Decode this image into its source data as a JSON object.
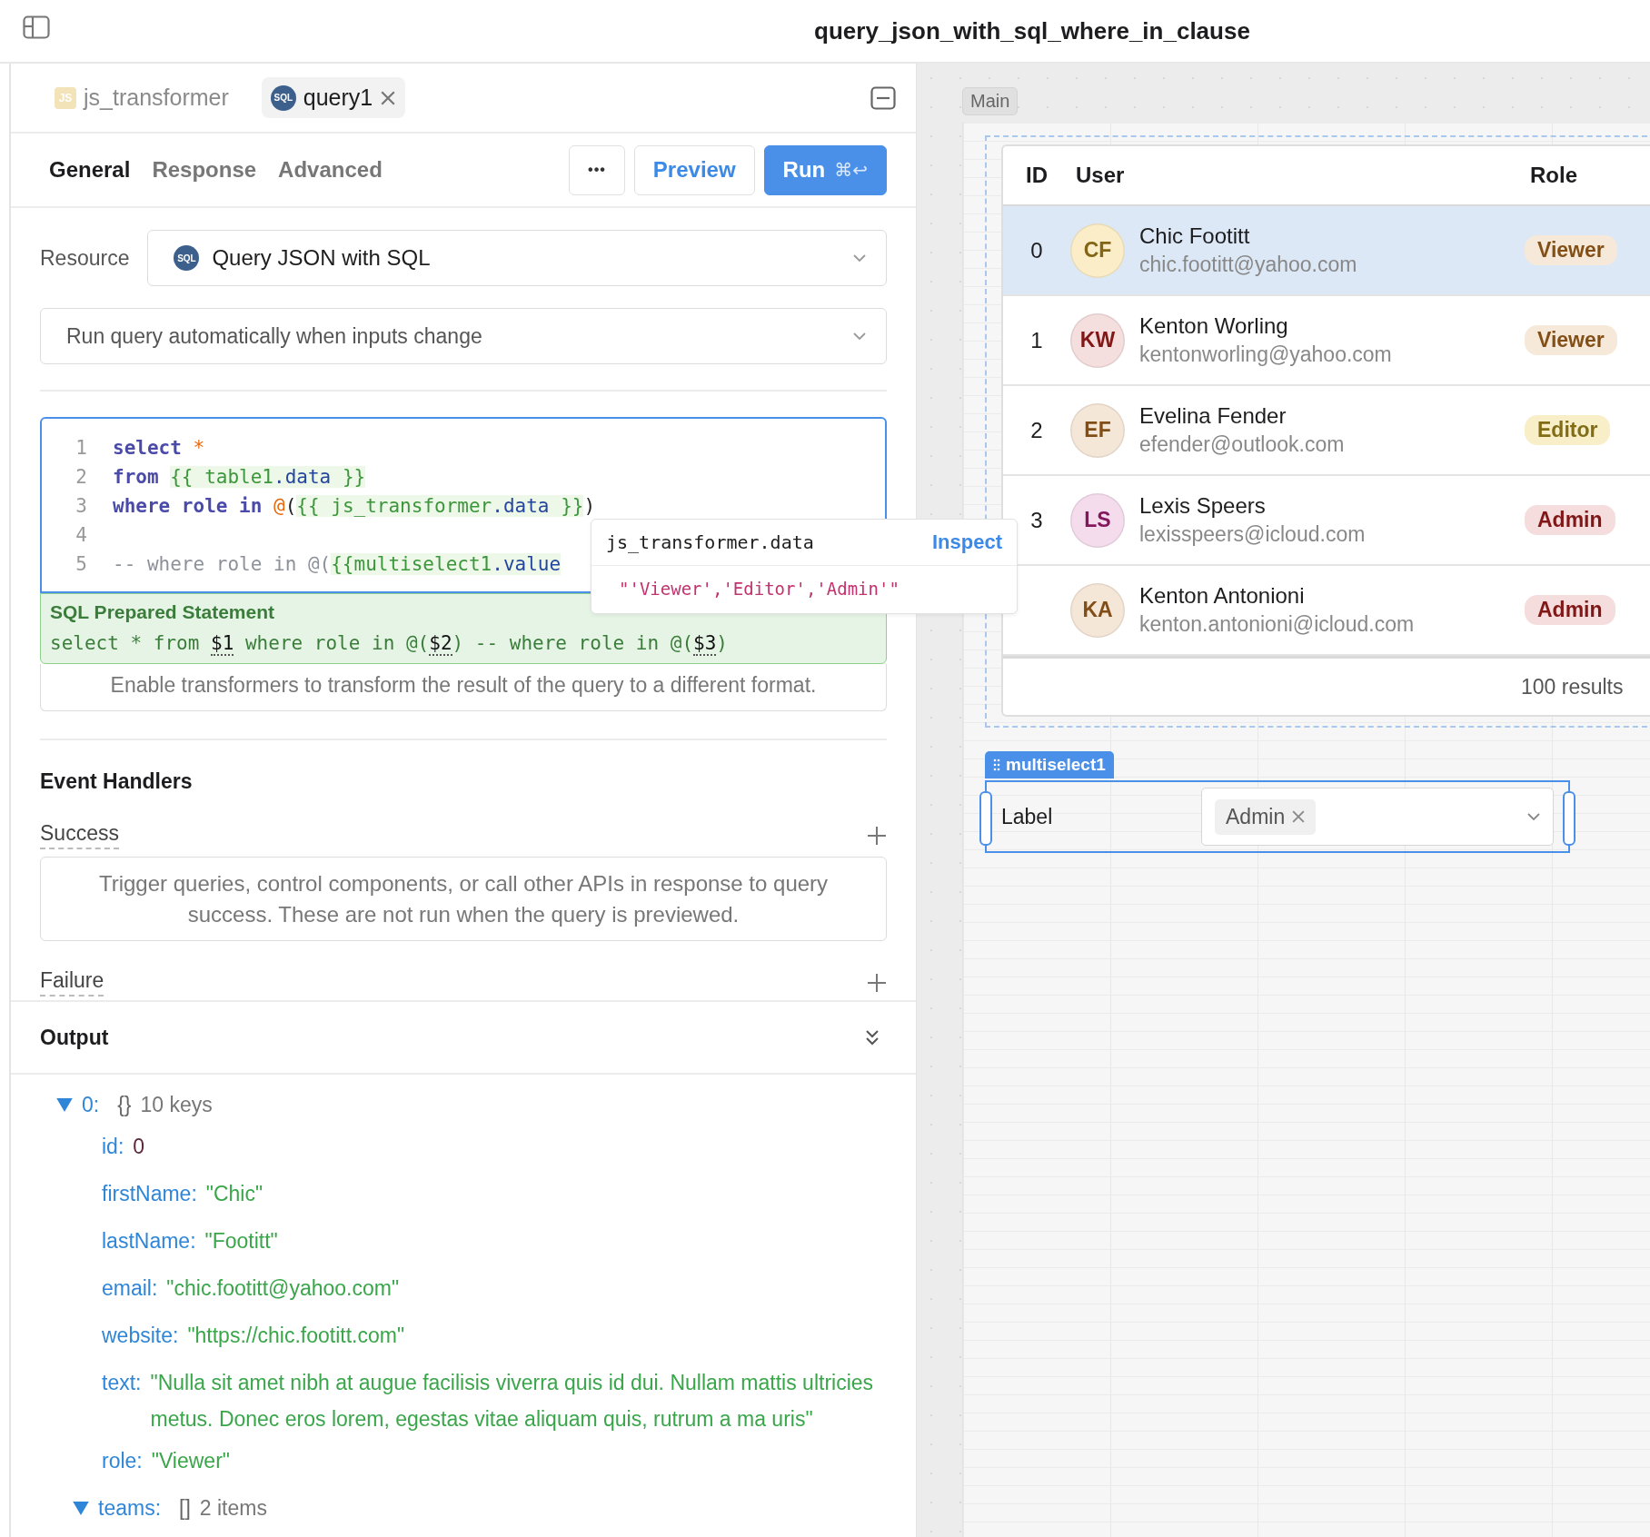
{
  "header": {
    "title": "query_json_with_sql_where_in_clause"
  },
  "editor_tabs": [
    {
      "label": "js_transformer",
      "kind": "js",
      "badge": "JS",
      "selected": false
    },
    {
      "label": "query1",
      "kind": "sql",
      "badge": "SQL",
      "selected": true
    }
  ],
  "section_tabs": [
    {
      "label": "General",
      "selected": true
    },
    {
      "label": "Response",
      "selected": false
    },
    {
      "label": "Advanced",
      "selected": false
    }
  ],
  "actions": {
    "more": "•••",
    "preview": "Preview",
    "run": "Run",
    "run_shortcut": "⌘↩"
  },
  "resource": {
    "label": "Resource",
    "badge": "SQL",
    "value": "Query JSON with SQL"
  },
  "run_mode": {
    "value": "Run query automatically when inputs change"
  },
  "code": {
    "lines": [
      {
        "number": "1",
        "tokens": [
          {
            "kind": "kw",
            "text": "select "
          },
          {
            "kind": "op",
            "text": "*"
          }
        ]
      },
      {
        "number": "2",
        "tokens": [
          {
            "kind": "kw",
            "text": "from "
          },
          {
            "kind": "tpl",
            "text": "{{ table1"
          },
          {
            "kind": "prop",
            "text": ".data"
          },
          {
            "kind": "tpl",
            "text": " }}"
          }
        ]
      },
      {
        "number": "3",
        "tokens": [
          {
            "kind": "kw",
            "text": "where role in "
          },
          {
            "kind": "op",
            "text": "@"
          },
          {
            "kind": "plain",
            "text": "("
          },
          {
            "kind": "tpl",
            "text": "{{ js_transformer"
          },
          {
            "kind": "prop",
            "text": ".data"
          },
          {
            "kind": "tpl",
            "text": " }}"
          },
          {
            "kind": "plain",
            "text": ")"
          }
        ]
      },
      {
        "number": "4"
      },
      {
        "number": "5",
        "tokens": [
          {
            "kind": "cmt",
            "text": "-- where role in @("
          },
          {
            "kind": "tpl",
            "text": "{{multiselect1"
          },
          {
            "kind": "prop",
            "text": ".value"
          }
        ]
      }
    ]
  },
  "tooltip": {
    "title": "js_transformer.data",
    "action": "Inspect",
    "value": "\"'Viewer','Editor','Admin'\""
  },
  "prepared_statement": {
    "title": "SQL Prepared Statement",
    "segments": [
      {
        "kind": "plain",
        "text": "select * from "
      },
      {
        "kind": "param",
        "text": "$1"
      },
      {
        "kind": "plain",
        "text": " where role in @("
      },
      {
        "kind": "param",
        "text": "$2"
      },
      {
        "kind": "plain",
        "text": ") -- where role in @("
      },
      {
        "kind": "param",
        "text": "$3"
      },
      {
        "kind": "plain",
        "text": ")"
      }
    ]
  },
  "transformers_hint": "Enable transformers to transform the result of the query to a different format.",
  "event_handlers": {
    "title": "Event Handlers",
    "groups": [
      {
        "label": "Success",
        "hint": "Trigger queries, control components, or call other APIs in response to query success. These are not run when the query is previewed."
      },
      {
        "label": "Failure"
      }
    ]
  },
  "output": {
    "title": "Output",
    "tree": [
      {
        "key": "0:",
        "kind": "object",
        "marker": "{}",
        "summary": "10 keys",
        "expanded": true,
        "children": [
          {
            "key": "id:",
            "kind": "number",
            "value": "0"
          },
          {
            "key": "firstName:",
            "kind": "string",
            "value": "\"Chic\""
          },
          {
            "key": "lastName:",
            "kind": "string",
            "value": "\"Footitt\""
          },
          {
            "key": "email:",
            "kind": "string",
            "value": "\"chic.footitt@yahoo.com\""
          },
          {
            "key": "website:",
            "kind": "string",
            "value": "\"https://chic.footitt.com\""
          },
          {
            "key": "text:",
            "kind": "string",
            "value": "\"Nulla sit amet nibh at augue facilisis viverra quis id dui. Nullam mattis ultricies metus. Donec eros lorem, egestas vitae aliquam quis, rutrum a ma uris\""
          },
          {
            "key": "role:",
            "kind": "string",
            "value": "\"Viewer\""
          },
          {
            "key": "teams:",
            "kind": "array",
            "marker": "[]",
            "summary": "2 items",
            "expanded": true
          }
        ]
      }
    ]
  },
  "canvas": {
    "frame_label": "Main",
    "table": {
      "columns": [
        "ID",
        "User",
        "Role"
      ],
      "rows": [
        {
          "id": "0",
          "avatar": {
            "initials": "CF",
            "color": "#faedc8"
          },
          "name": "Chic Footitt",
          "email": "chic.footitt@yahoo.com",
          "role": {
            "label": "Viewer",
            "color": "#f6e9da"
          },
          "selected": true
        },
        {
          "id": "1",
          "avatar": {
            "initials": "KW",
            "color": "#f5dede"
          },
          "name": "Kenton Worling",
          "email": "kentonworling@yahoo.com",
          "role": {
            "label": "Viewer",
            "color": "#f6e9da"
          },
          "selected": false
        },
        {
          "id": "2",
          "avatar": {
            "initials": "EF",
            "color": "#f5e7d8"
          },
          "name": "Evelina Fender",
          "email": "efender@outlook.com",
          "role": {
            "label": "Editor",
            "color": "#f8eec8"
          },
          "selected": false
        },
        {
          "id": "3",
          "avatar": {
            "initials": "LS",
            "color": "#f4dcec"
          },
          "name": "Lexis Speers",
          "email": "lexisspeers@icloud.com",
          "role": {
            "label": "Admin",
            "color": "#f6dddd"
          },
          "selected": false
        },
        {
          "avatar": {
            "initials": "KA",
            "color": "#f5e7d8"
          },
          "name": "Kenton Antonioni",
          "email": "kenton.antonioni@icloud.com",
          "role": {
            "label": "Admin",
            "color": "#f6dddd"
          },
          "selected": false
        }
      ],
      "footer": "100 results"
    },
    "multiselect": {
      "name": "multiselect1",
      "label": "Label",
      "chips": [
        "Admin"
      ]
    }
  }
}
